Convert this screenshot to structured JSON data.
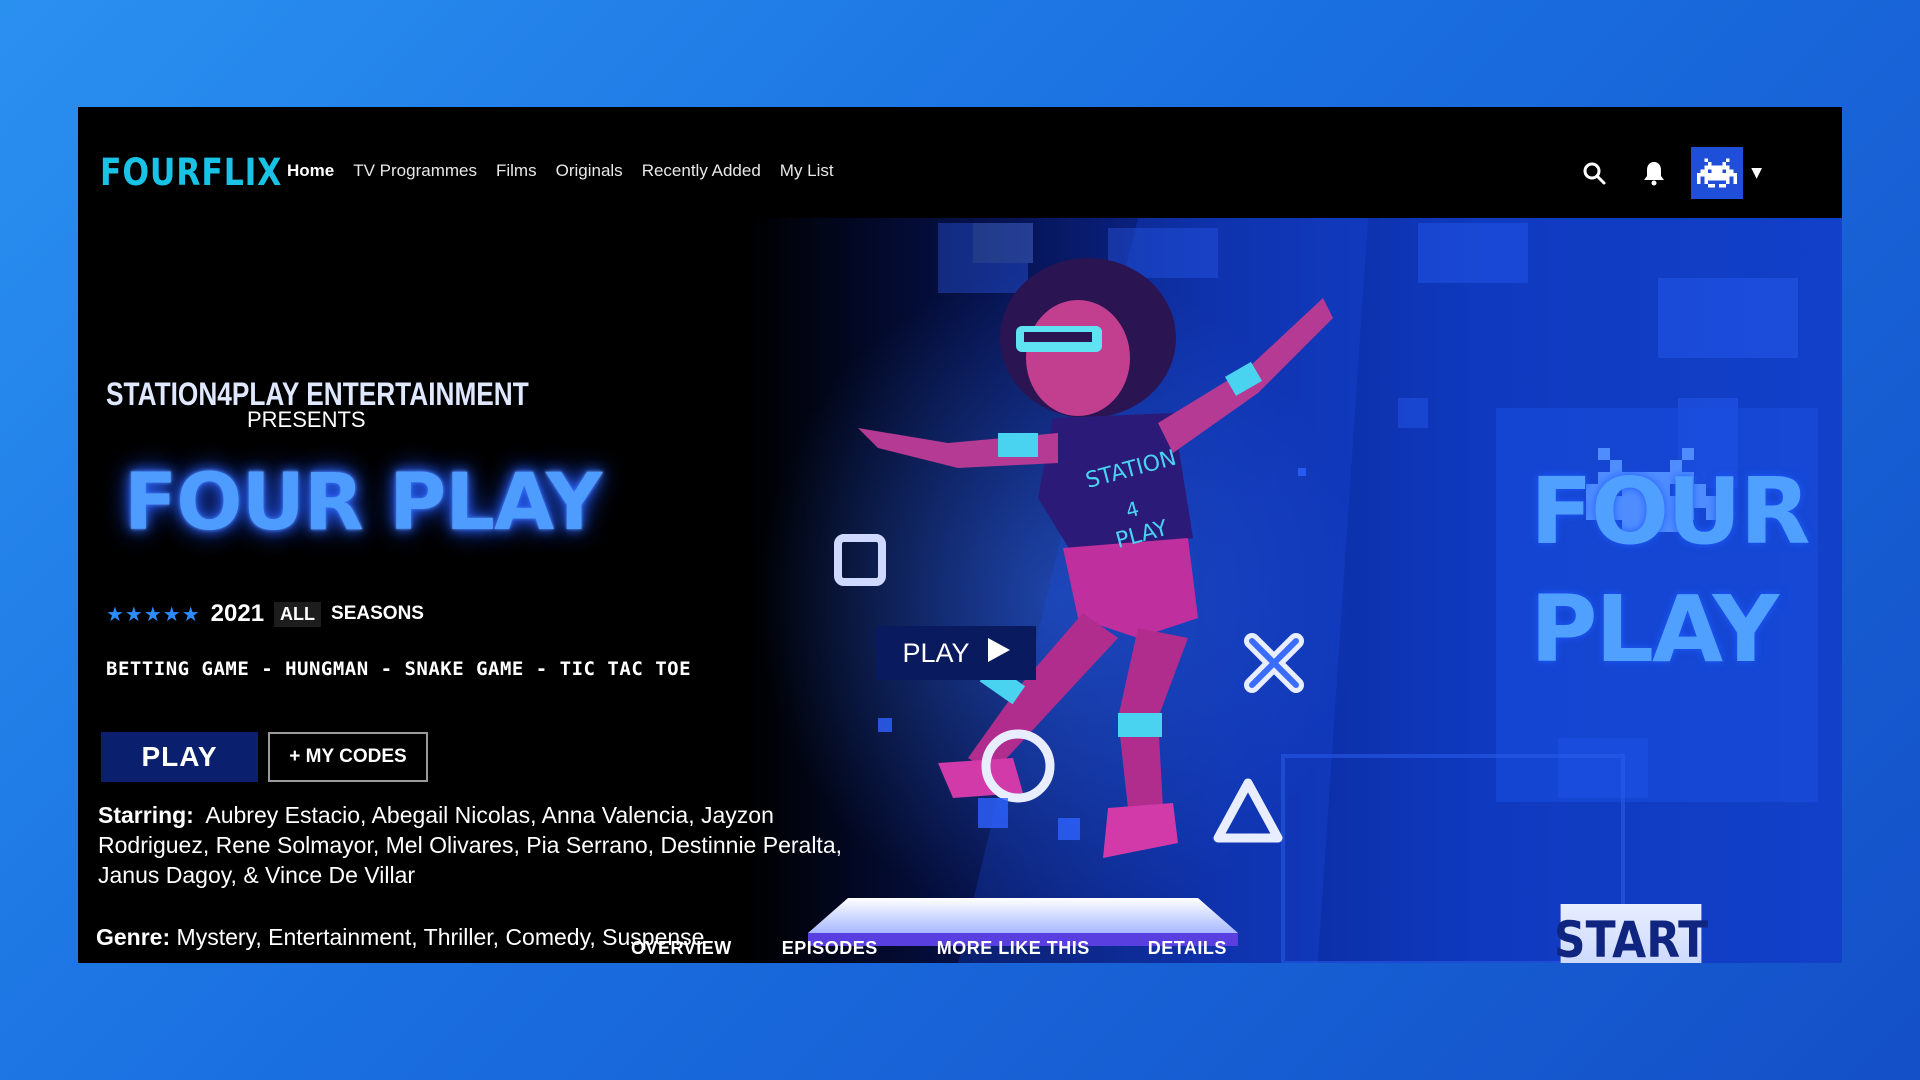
{
  "brand": {
    "logo": "FOURFLIX"
  },
  "nav": {
    "links": [
      "Home",
      "TV Programmes",
      "Films",
      "Originals",
      "Recently Added",
      "My List"
    ],
    "active": "Home",
    "icons": [
      "search-icon",
      "bell-icon",
      "space-invader-avatar-icon",
      "caret-down-icon"
    ]
  },
  "hero": {
    "studio": "STATION4PLAY ENTERTAINMENT",
    "presents": "PRESENTS",
    "title": "FOUR PLAY",
    "rating_stars": "★★★★★",
    "year": "2021",
    "age_rating": "ALL",
    "seasons": "SEASONS",
    "games": "BETTING GAME - HUNGMAN - SNAKE GAME - TIC TAC TOE",
    "play_label": "PLAY",
    "codes_label": "+ MY CODES",
    "starring_label": "Starring:",
    "starring_names": "Aubrey Estacio, Abegail Nicolas, Anna Valencia, Jayzon Rodriguez, Rene Solmayor, Mel Olivares, Pia Serrano, Destinnie Peralta, Janus Dagoy,  & Vince De Villar",
    "genre_label": "Genre:",
    "genre_values": "Mystery, Entertainment, Thriller, Comedy, Suspense",
    "video_play_label": "PLAY",
    "poster_title_line1": "FOUR",
    "poster_title_line2": "PLAY",
    "start_label": "START",
    "shirt_text": "STATION 4 PLAY"
  },
  "tabs": [
    "OVERVIEW",
    "EPISODES",
    "MORE LIKE THIS",
    "DETAILS"
  ],
  "tab_active": "OVERVIEW",
  "colors": {
    "accent": "#19c3e6",
    "navy": "#0a1f6e",
    "glow_blue": "#4f9cff",
    "pink": "#d63ab5"
  }
}
